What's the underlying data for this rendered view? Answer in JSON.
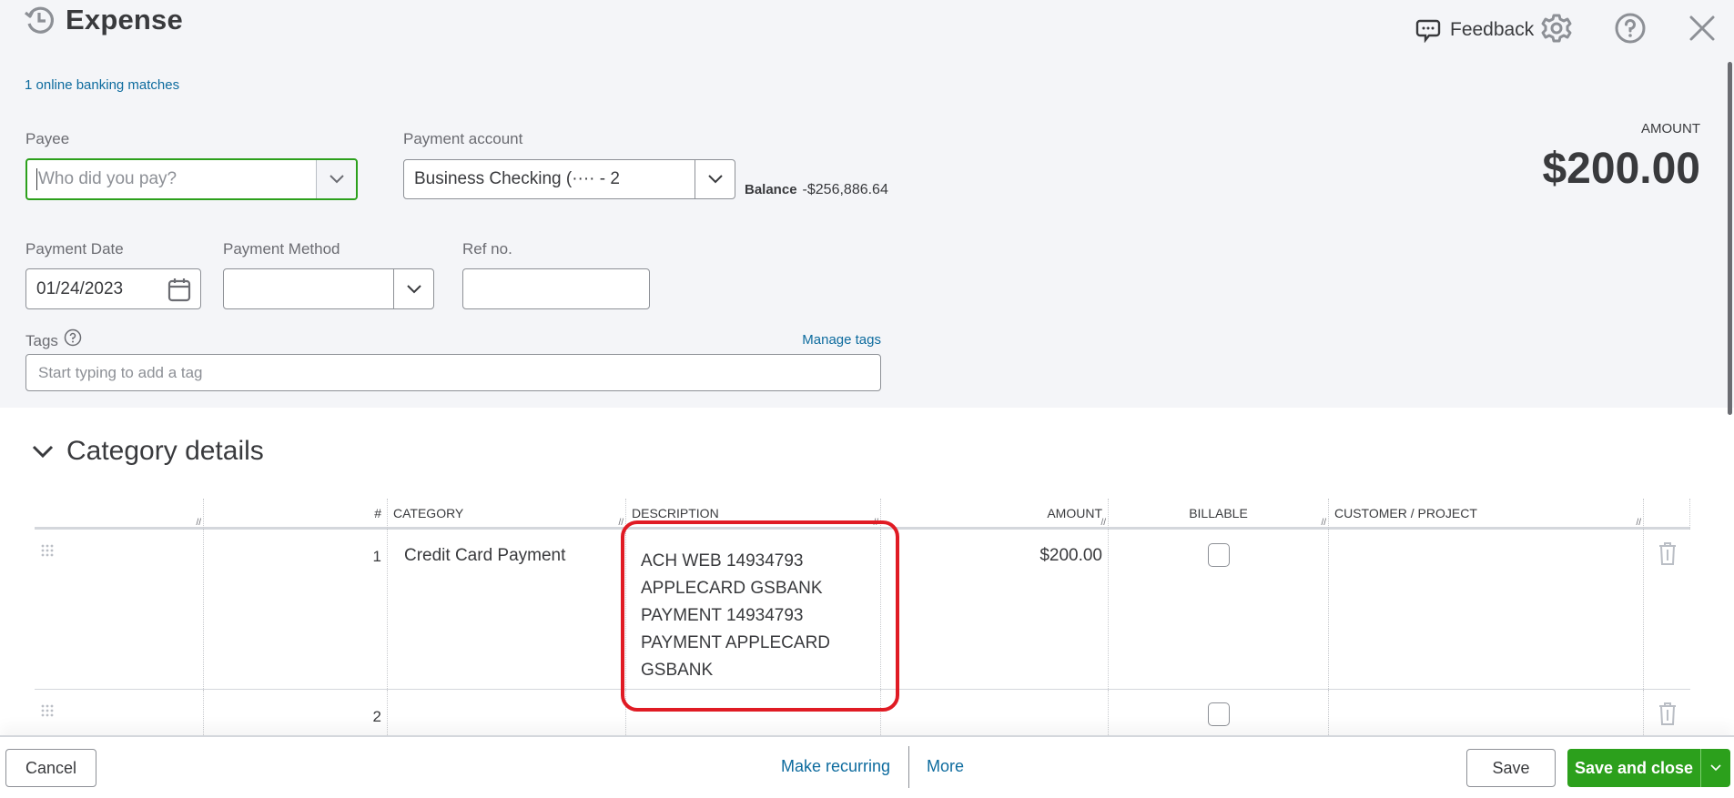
{
  "header": {
    "title": "Expense",
    "history_icon": "history-clock-icon",
    "bank_matches_link": "1 online banking matches",
    "feedback_label": "Feedback",
    "icons": [
      "feedback-chat-icon",
      "gear-icon",
      "help-icon",
      "close-icon"
    ]
  },
  "form": {
    "payee": {
      "label": "Payee",
      "value": "",
      "placeholder": "Who did you pay?"
    },
    "payment_account": {
      "label": "Payment account",
      "value": "Business Checking (···· - 2"
    },
    "balance": {
      "label": "Balance",
      "value": "-$256,886.64"
    },
    "amount": {
      "label": "AMOUNT",
      "value": "$200.00"
    },
    "payment_date": {
      "label": "Payment Date",
      "value": "01/24/2023"
    },
    "payment_method": {
      "label": "Payment Method",
      "value": ""
    },
    "ref_no": {
      "label": "Ref no.",
      "value": ""
    },
    "tags": {
      "label": "Tags",
      "manage_link": "Manage tags",
      "placeholder": "Start typing to add a tag"
    }
  },
  "category_details": {
    "title": "Category details",
    "columns": [
      "#",
      "CATEGORY",
      "DESCRIPTION",
      "AMOUNT",
      "BILLABLE",
      "CUSTOMER / PROJECT"
    ],
    "rows": [
      {
        "num": "1",
        "category": "Credit Card Payment",
        "description": "ACH WEB 14934793 APPLECARD GSBANK PAYMENT 14934793 PAYMENT APPLECARD GSBANK",
        "description_lines": [
          "ACH WEB 14934793",
          "APPLECARD GSBANK",
          "PAYMENT 14934793",
          "PAYMENT APPLECARD",
          "GSBANK"
        ],
        "amount": "$200.00",
        "billable": false,
        "customer": ""
      },
      {
        "num": "2",
        "category": "",
        "description": "",
        "amount": "",
        "billable": false,
        "customer": ""
      }
    ],
    "highlight_color": "#e01b24"
  },
  "footer": {
    "cancel": "Cancel",
    "make_recurring": "Make recurring",
    "more": "More",
    "save": "Save",
    "save_and_close": "Save and close"
  },
  "colors": {
    "brand_green": "#2ca01c",
    "link_blue": "#0d6b9e",
    "text": "#393a3d",
    "background": "#f4f5f8"
  }
}
